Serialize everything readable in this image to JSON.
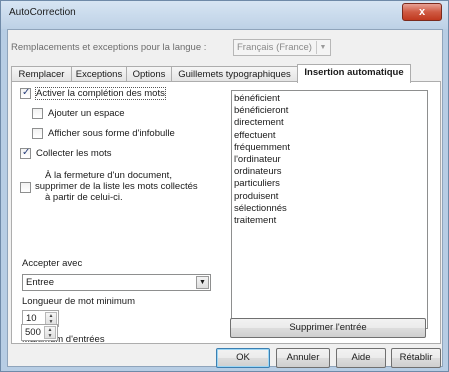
{
  "window": {
    "title": "AutoCorrection",
    "close_label": "x"
  },
  "language": {
    "label": "Remplacements et exceptions pour la langue :",
    "value": "Français (France)"
  },
  "tabs": [
    {
      "label": "Remplacer"
    },
    {
      "label": "Exceptions"
    },
    {
      "label": "Options"
    },
    {
      "label": "Guillemets typographiques"
    },
    {
      "label": "Insertion automatique",
      "active": true
    }
  ],
  "options": {
    "activate_completion": {
      "label": "Activer la complétion des mots",
      "checked": true
    },
    "append_space": {
      "label": "Ajouter un espace",
      "checked": false
    },
    "show_tooltip": {
      "label": "Afficher sous forme d'infobulle",
      "checked": false
    },
    "collect_words": {
      "label": "Collecter les mots",
      "checked": true
    },
    "remove_on_close": {
      "line1": "À la fermeture d'un document,",
      "line2": "supprimer de la liste les mots collectés",
      "line3": "à partir de celui-ci.",
      "checked": false
    }
  },
  "accept_with": {
    "label": "Accepter avec",
    "value": "Entree"
  },
  "min_word_length": {
    "label": "Longueur de mot minimum",
    "value": "10"
  },
  "max_entries": {
    "label": "Maximum d'entrées",
    "value": "500"
  },
  "word_list": [
    "bénéficient",
    "bénéficieront",
    "directement",
    "effectuent",
    "fréquemment",
    "l'ordinateur",
    "ordinateurs",
    "particuliers",
    "produisent",
    "sélectionnés",
    "traitement"
  ],
  "buttons": {
    "delete_entry": "Supprimer l'entrée",
    "ok": "OK",
    "cancel": "Annuler",
    "help": "Aide",
    "reset": "Rétablir"
  }
}
